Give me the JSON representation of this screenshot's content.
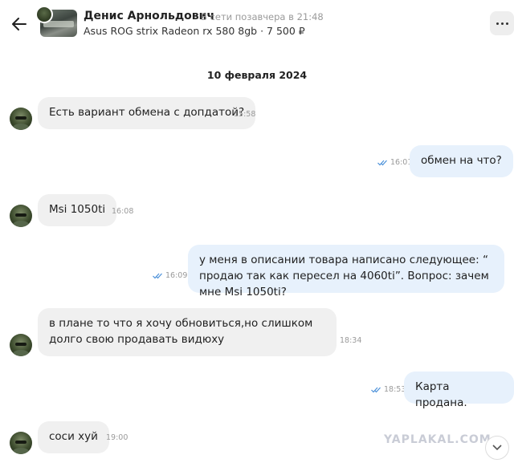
{
  "header": {
    "name": "Денис Арнольдович",
    "status": "В сети позавчера в 21:48",
    "listing": "Asus ROG strix Radeon rx 580 8gb · 7 500 ₽"
  },
  "date_separator": "10 февраля 2024",
  "messages": [
    {
      "dir": "in",
      "text": "Есть вариант обмена с допдатой?",
      "time": "15:58"
    },
    {
      "dir": "out",
      "text": "обмен на что?",
      "time": "16:01"
    },
    {
      "dir": "in",
      "text": "Msi 1050ti",
      "time": "16:08"
    },
    {
      "dir": "out",
      "text": "у меня в описании товара написано следующее: “ продаю так как пересел на 4060ti”. Вопрос: зачем мне Msi 1050ti?",
      "time": "16:09"
    },
    {
      "dir": "in",
      "text": "в плане то что я хочу обновиться,но слишком долго свою продавать видюху",
      "time": "18:34"
    },
    {
      "dir": "out",
      "text": "Карта продана.",
      "time": "18:53"
    },
    {
      "dir": "in",
      "text": "соси хуй",
      "time": "19:00"
    }
  ],
  "watermark": "YAPLAKAL.COM",
  "colors": {
    "incoming_bubble": "#f0f0f0",
    "outgoing_bubble": "#e7f1fc",
    "read_check": "#4a90d9"
  },
  "icons": [
    "back-arrow-icon",
    "more-icon",
    "double-check-icon",
    "chevron-down-icon"
  ]
}
